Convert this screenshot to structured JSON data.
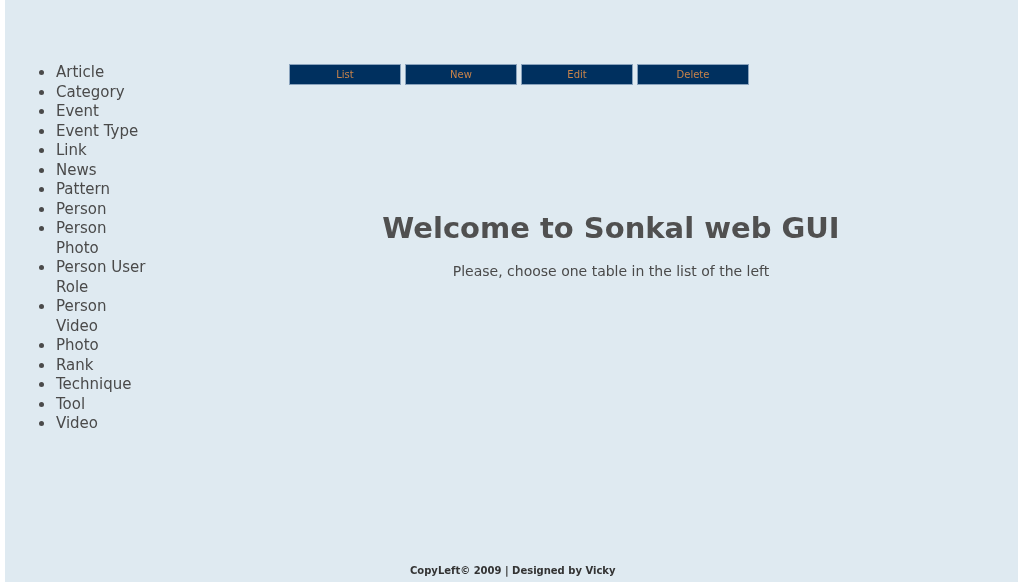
{
  "sidebar": {
    "items": [
      "Article",
      "Category",
      "Event",
      "Event Type",
      "Link",
      "News",
      "Pattern",
      "Person",
      "Person Photo",
      "Person User Role",
      "Person Video",
      "Photo",
      "Rank",
      "Technique",
      "Tool",
      "Video"
    ]
  },
  "toolbar": {
    "buttons": [
      "List",
      "New",
      "Edit",
      "Delete"
    ]
  },
  "main": {
    "heading": "Welcome to Sonkal web GUI",
    "subtitle": "Please, choose one table in the list of the left"
  },
  "footer": "CopyLeft© 2009 | Designed by Vicky"
}
